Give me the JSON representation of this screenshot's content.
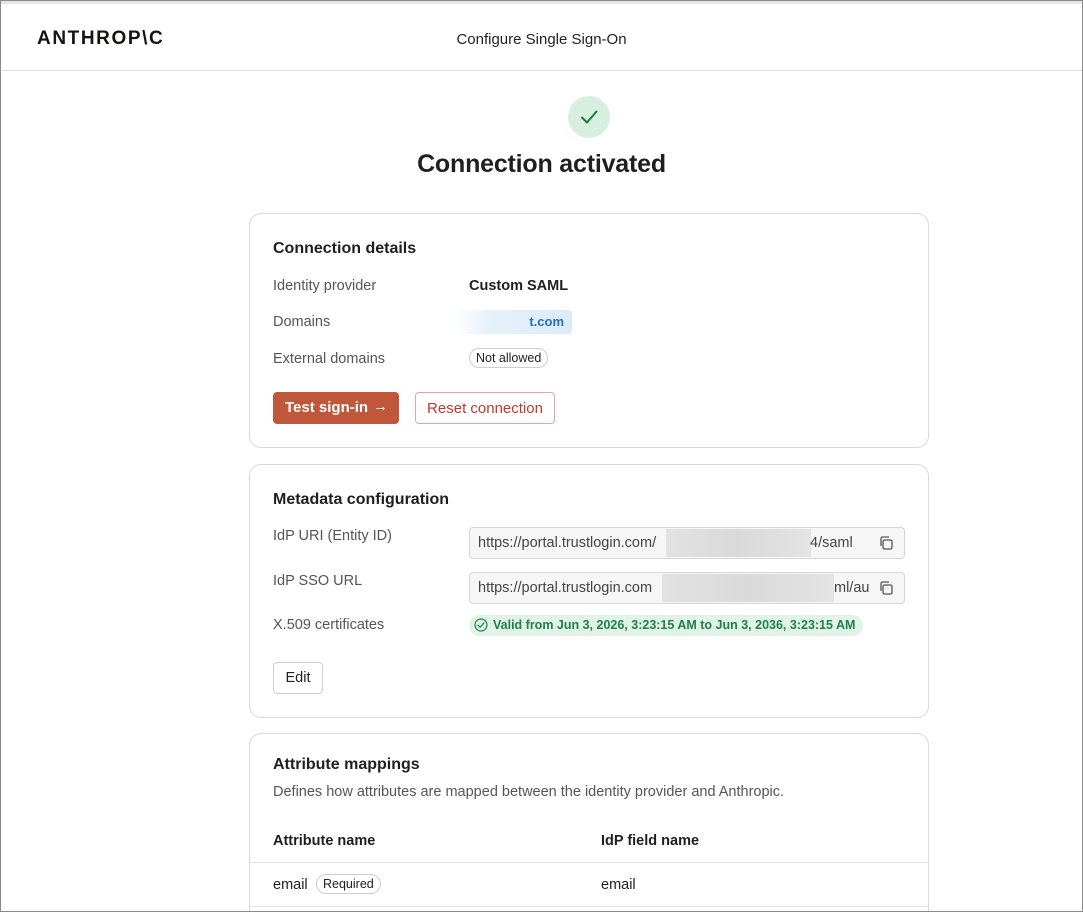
{
  "header": {
    "logo": "ANTHROP\\C",
    "title": "Configure Single Sign-On"
  },
  "status": {
    "heading": "Connection activated"
  },
  "connection_details": {
    "title": "Connection details",
    "identity_provider_label": "Identity provider",
    "identity_provider_value": "Custom SAML",
    "domains_label": "Domains",
    "domains_value": "t.com",
    "external_domains_label": "External domains",
    "external_domains_value": "Not allowed",
    "test_button": "Test sign-in",
    "test_button_arrow": "→",
    "reset_button": "Reset connection"
  },
  "metadata": {
    "title": "Metadata configuration",
    "idp_uri_label": "IdP URI (Entity ID)",
    "idp_uri_value_start": "https://portal.trustlogin.com/",
    "idp_uri_value_end": "4/saml",
    "idp_sso_label": "IdP SSO URL",
    "idp_sso_value_start": "https://portal.trustlogin.com",
    "idp_sso_value_end": "ml/au",
    "cert_label": "X.509 certificates",
    "cert_value": "Valid from Jun 3, 2026, 3:23:15 AM to Jun 3, 2036, 3:23:15 AM",
    "edit_button": "Edit"
  },
  "attributes": {
    "title": "Attribute mappings",
    "description": "Defines how attributes are mapped between the identity provider and Anthropic.",
    "col_attribute": "Attribute name",
    "col_idp_field": "IdP field name",
    "rows": [
      {
        "attribute": "email",
        "badge": "Required",
        "idp_field": "email"
      }
    ]
  },
  "colors": {
    "accent": "#c0573b",
    "success_bg": "#e1f3e7",
    "success_text": "#21804a",
    "danger": "#c0392b"
  }
}
